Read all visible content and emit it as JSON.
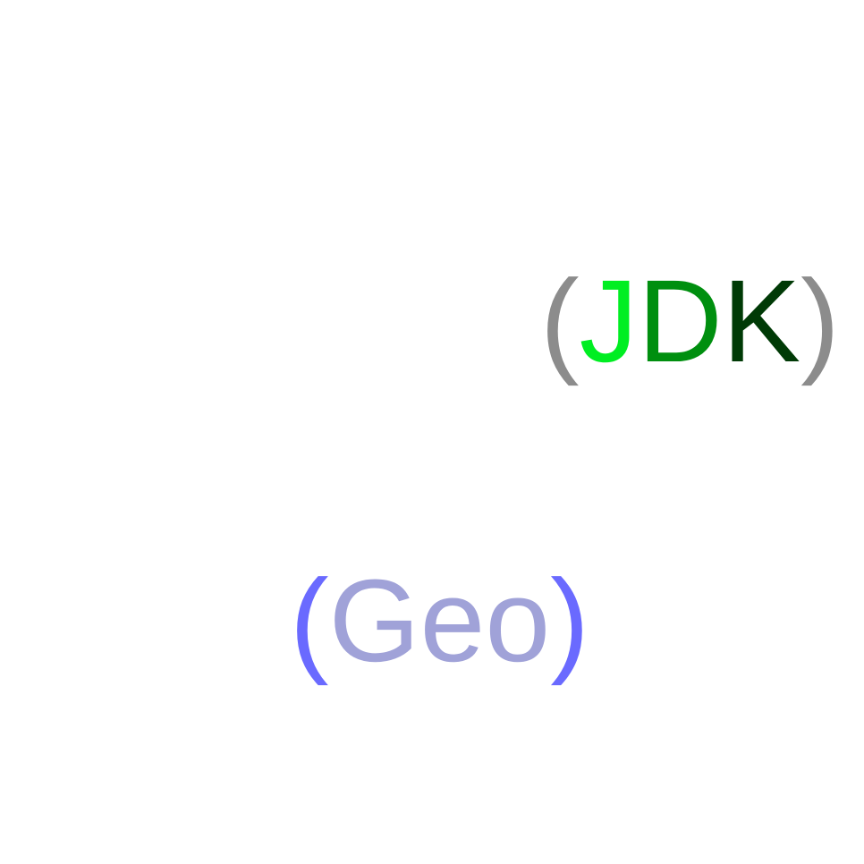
{
  "labels": {
    "jdk": {
      "open_paren": "(",
      "letters": [
        "J",
        "D",
        "K"
      ],
      "close_paren": ")",
      "colors": {
        "paren": "#8c8c8c",
        "letters": [
          "#00ee22",
          "#008f0f",
          "#003a06"
        ]
      }
    },
    "geo": {
      "open_paren": "(",
      "letters": [
        "Geo"
      ],
      "close_paren": ")",
      "colors": {
        "paren": "#6a6aff",
        "letters": [
          "#a0a2d8"
        ]
      }
    }
  }
}
